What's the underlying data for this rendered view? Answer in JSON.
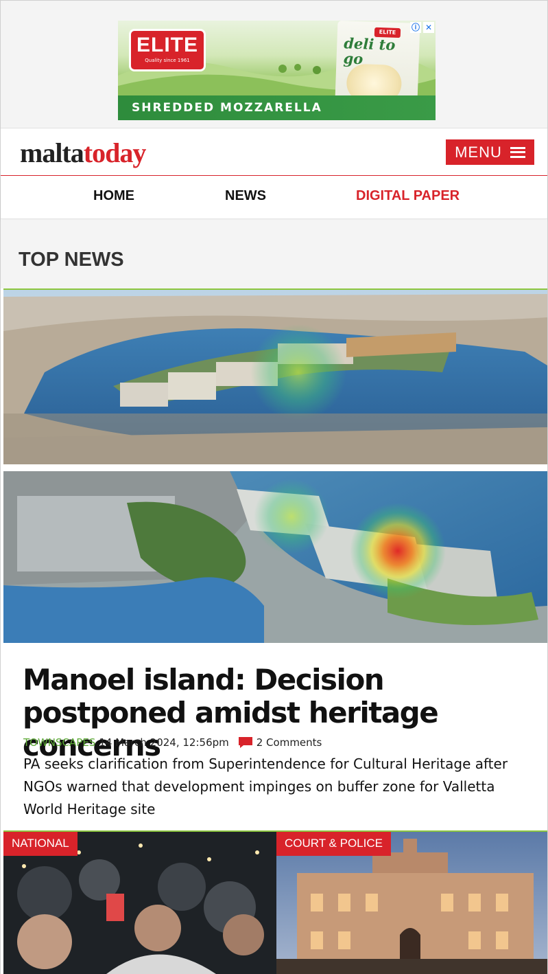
{
  "ad": {
    "brand": "ELITE",
    "brand_sub": "Quality since 1961",
    "product": "deli to go",
    "tagline": "SHREDDED MOZZARELLA",
    "info_icon": "info-icon",
    "close_icon": "close-icon"
  },
  "header": {
    "logo_part1": "malta",
    "logo_part2": "today",
    "menu_label": "MENU",
    "menu_icon": "hamburger-icon"
  },
  "nav": {
    "items": [
      {
        "label": "HOME"
      },
      {
        "label": "NEWS"
      },
      {
        "label": "DIGITAL PAPER"
      }
    ]
  },
  "section": {
    "title": "TOP NEWS"
  },
  "article": {
    "headline": "Manoel island: Decision postponed amidst heritage concerns",
    "category": "TOWNSCAPES",
    "date": "14 March 2024, 12:56pm",
    "comments": "2 Comments",
    "summary": "PA seeks clarification from Superintendence for Cultural Heritage after NGOs warned that development impinges on buffer zone for Valletta World Heritage site"
  },
  "cards": [
    {
      "tag": "NATIONAL"
    },
    {
      "tag": "COURT & POLICE"
    }
  ],
  "colors": {
    "brand_red": "#d8232a",
    "category_green": "#5ca935",
    "accent_line": "#8cc63f"
  }
}
